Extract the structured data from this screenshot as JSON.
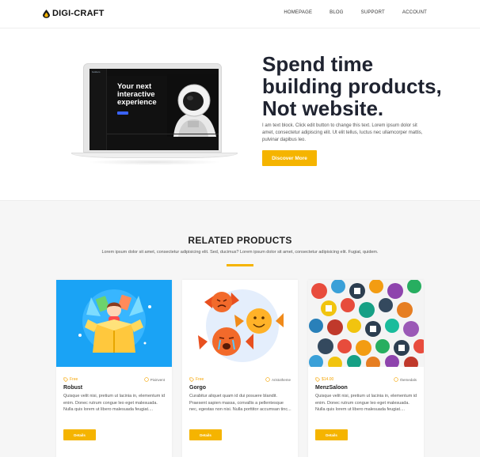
{
  "brand": {
    "name": "DIGI-CRAFT"
  },
  "nav": {
    "items": [
      "HOMEPAGE",
      "BLOG",
      "SUPPORT",
      "ACCOUNT"
    ]
  },
  "hero": {
    "title": "Spend time building products, Not website.",
    "text": "I am text block. Click edit button to change this text. Lorem ipsum dolor sit amet, consectetur adipiscing elit. Ut elit tellus, luctus nec ullamcorper mattis, pulvinar dapibus leo.",
    "button": "Discover More",
    "screen": {
      "brand": "builders",
      "headline": "Your next interactive experience"
    }
  },
  "related": {
    "title": "RELATED PRODUCTS",
    "subtitle": "Lorem ipsum dolor sit amet, consectetur adipisicing elit. Sed, ducimus? Lorem ipsum dolor sit amet, consectetur adipisicing elit. Fugiat, quidem.",
    "cards": [
      {
        "price": "Free",
        "author": "Pixinvent",
        "name": "Robust",
        "desc": "Quisque velit nisi, pretium ut lacinia in, elementum id enim. Donec rutrum congue leo eget malesuada. Nulla quis lorem ut libero malesuada feugiat....",
        "button": "Details"
      },
      {
        "price": "Free",
        "author": "Aristotheme",
        "name": "Gorgo",
        "desc": "Curabitur aliquet quam id dui posuere blandit. Praesent sapien massa, convallis a pellentesque nec, egestas non nisi. Nulla porttitor accumsan tinc...",
        "button": "Details"
      },
      {
        "price": "$14.00",
        "author": "themedals",
        "name": "MenzSaloon",
        "desc": "Quisque velit nisi, pretium ut lacinia in, elementum id enim. Donec rutrum congue leo eget malesuada. Nulla quis lorem ut libero malesuada feugiat....",
        "button": "Details"
      }
    ]
  },
  "colors": {
    "accent": "#f5b400",
    "heading": "#1f2330",
    "background_alt": "#f6f6f6"
  }
}
